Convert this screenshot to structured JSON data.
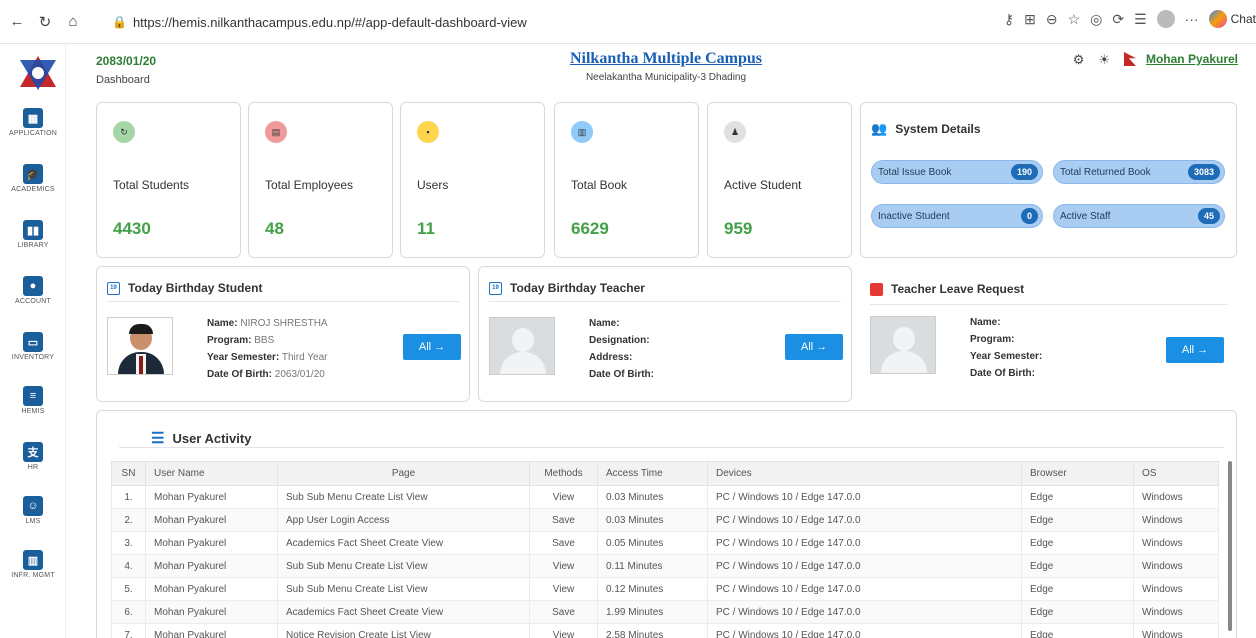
{
  "browser": {
    "url": "https://hemis.nilkanthacampus.edu.np/#/app-default-dashboard-view",
    "chat_label": "Chat"
  },
  "sidebar": {
    "items": [
      {
        "label": "APPLICATION",
        "icon": "grid-icon"
      },
      {
        "label": "ACADEMICS",
        "icon": "graduation-cap-icon"
      },
      {
        "label": "LIBRARY",
        "icon": "book-icon"
      },
      {
        "label": "ACCOUNT",
        "icon": "account-icon"
      },
      {
        "label": "INVENTORY",
        "icon": "archive-icon"
      },
      {
        "label": "HEMIS",
        "icon": "document-icon"
      },
      {
        "label": "HR",
        "icon": "hr-icon"
      },
      {
        "label": "LMS",
        "icon": "teacher-icon"
      },
      {
        "label": "INFR. MGMT",
        "icon": "building-icon"
      }
    ]
  },
  "header": {
    "date": "2083/01/20",
    "breadcrumb": "Dashboard",
    "campus_name": "Nilkantha Multiple Campus",
    "campus_address": "Neelakantha Municipality-3 Dhading",
    "user_name": "Mohan Pyakurel"
  },
  "stats": [
    {
      "label": "Total Students",
      "value": "4430",
      "color": "#a5d6a7"
    },
    {
      "label": "Total Employees",
      "value": "48",
      "color": "#ef9a9a"
    },
    {
      "label": "Users",
      "value": "11",
      "color": "#ffd54f"
    },
    {
      "label": "Total Book",
      "value": "6629",
      "color": "#90caf9"
    },
    {
      "label": "Active Student",
      "value": "959",
      "color": "#e0e0e0"
    }
  ],
  "system": {
    "title": "System Details",
    "items": [
      {
        "label": "Total Issue Book",
        "count": "190"
      },
      {
        "label": "Total Returned Book",
        "count": "3083"
      },
      {
        "label": "Inactive Student",
        "count": "0"
      },
      {
        "label": "Active Staff",
        "count": "45"
      }
    ]
  },
  "birthday_student": {
    "title": "Today Birthday Student",
    "cal_day": "19",
    "name_label": "Name:",
    "name": "NIROJ SHRESTHA",
    "program_label": "Program:",
    "program": "BBS",
    "semester_label": "Year Semester:",
    "semester": "Third Year",
    "dob_label": "Date Of Birth:",
    "dob": "2063/01/20",
    "button": "All →"
  },
  "birthday_teacher": {
    "title": "Today Birthday Teacher",
    "cal_day": "19",
    "name_label": "Name:",
    "designation_label": "Designation:",
    "address_label": "Address:",
    "dob_label": "Date Of Birth:",
    "button": "All →"
  },
  "leave_request": {
    "title": "Teacher Leave Request",
    "name_label": "Name:",
    "program_label": "Program:",
    "semester_label": "Year Semester:",
    "dob_label": "Date Of Birth:",
    "button": "All →"
  },
  "activity": {
    "title": "User Activity",
    "columns": [
      "SN",
      "User Name",
      "Page",
      "Methods",
      "Access Time",
      "Devices",
      "Browser",
      "OS"
    ],
    "rows": [
      [
        "1.",
        "Mohan Pyakurel",
        "Sub Sub Menu Create List View",
        "View",
        "0.03 Minutes",
        "PC / Windows 10 / Edge 147.0.0",
        "Edge",
        "Windows"
      ],
      [
        "2.",
        "Mohan Pyakurel",
        "App User Login Access",
        "Save",
        "0.03 Minutes",
        "PC / Windows 10 / Edge 147.0.0",
        "Edge",
        "Windows"
      ],
      [
        "3.",
        "Mohan Pyakurel",
        "Academics Fact Sheet Create View",
        "Save",
        "0.05 Minutes",
        "PC / Windows 10 / Edge 147.0.0",
        "Edge",
        "Windows"
      ],
      [
        "4.",
        "Mohan Pyakurel",
        "Sub Sub Menu Create List View",
        "View",
        "0.11 Minutes",
        "PC / Windows 10 / Edge 147.0.0",
        "Edge",
        "Windows"
      ],
      [
        "5.",
        "Mohan Pyakurel",
        "Sub Sub Menu Create List View",
        "View",
        "0.12 Minutes",
        "PC / Windows 10 / Edge 147.0.0",
        "Edge",
        "Windows"
      ],
      [
        "6.",
        "Mohan Pyakurel",
        "Academics Fact Sheet Create View",
        "Save",
        "1.99 Minutes",
        "PC / Windows 10 / Edge 147.0.0",
        "Edge",
        "Windows"
      ],
      [
        "7.",
        "Mohan Pyakurel",
        "Notice Revision Create List View",
        "View",
        "2.58 Minutes",
        "PC / Windows 10 / Edge 147.0.0",
        "Edge",
        "Windows"
      ]
    ]
  }
}
